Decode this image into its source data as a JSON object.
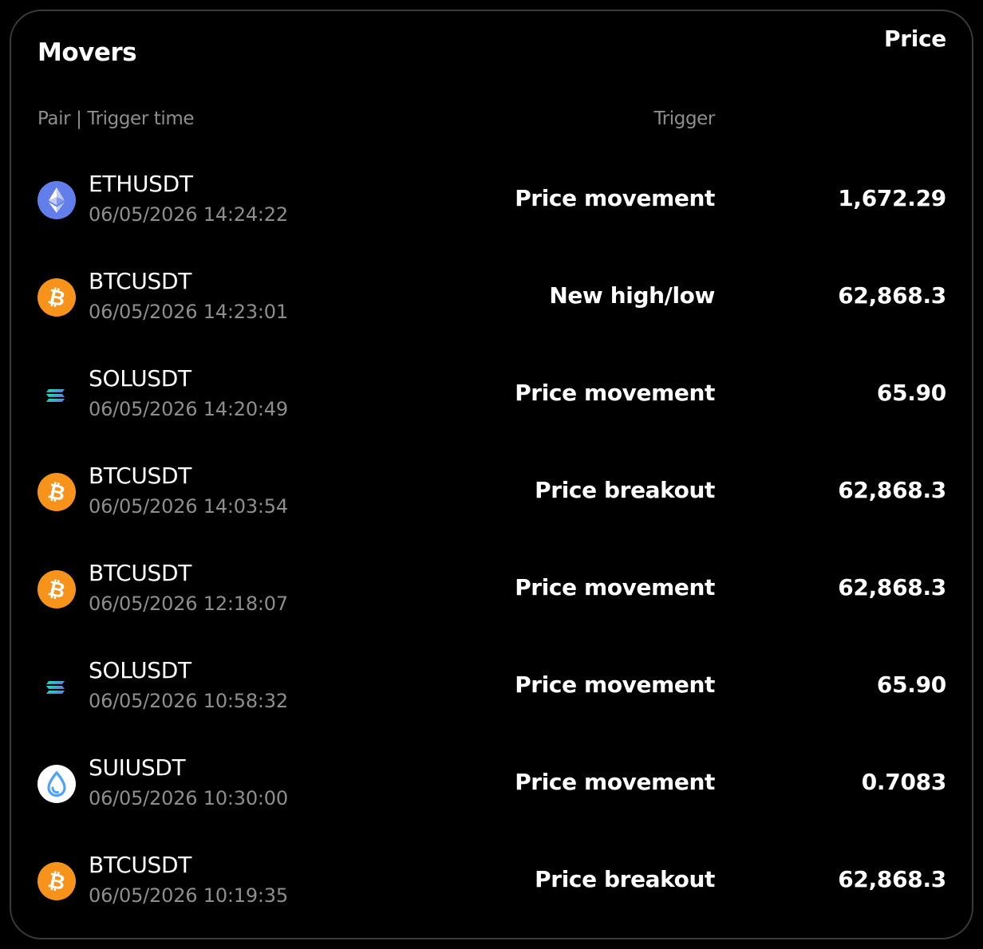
{
  "panel": {
    "title": "Movers",
    "headers": {
      "pair": "Pair | Trigger time",
      "trigger": "Trigger",
      "price": "Price"
    }
  },
  "colors": {
    "background": "#000000",
    "border": "#3a3a3a",
    "muted_text": "#8e8e8e",
    "eth": "#627eea",
    "btc": "#f7931a",
    "sui": "#4da2ff"
  },
  "rows": [
    {
      "icon": "eth-icon",
      "pair": "ETHUSDT",
      "time": "06/05/2026 14:24:22",
      "trigger": "Price movement",
      "price": "1,672.29"
    },
    {
      "icon": "btc-icon",
      "pair": "BTCUSDT",
      "time": "06/05/2026 14:23:01",
      "trigger": "New high/low",
      "price": "62,868.3"
    },
    {
      "icon": "sol-icon",
      "pair": "SOLUSDT",
      "time": "06/05/2026 14:20:49",
      "trigger": "Price movement",
      "price": "65.90"
    },
    {
      "icon": "btc-icon",
      "pair": "BTCUSDT",
      "time": "06/05/2026 14:03:54",
      "trigger": "Price breakout",
      "price": "62,868.3"
    },
    {
      "icon": "btc-icon",
      "pair": "BTCUSDT",
      "time": "06/05/2026 12:18:07",
      "trigger": "Price movement",
      "price": "62,868.3"
    },
    {
      "icon": "sol-icon",
      "pair": "SOLUSDT",
      "time": "06/05/2026 10:58:32",
      "trigger": "Price movement",
      "price": "65.90"
    },
    {
      "icon": "sui-icon",
      "pair": "SUIUSDT",
      "time": "06/05/2026 10:30:00",
      "trigger": "Price movement",
      "price": "0.7083"
    },
    {
      "icon": "btc-icon",
      "pair": "BTCUSDT",
      "time": "06/05/2026 10:19:35",
      "trigger": "Price breakout",
      "price": "62,868.3"
    }
  ]
}
